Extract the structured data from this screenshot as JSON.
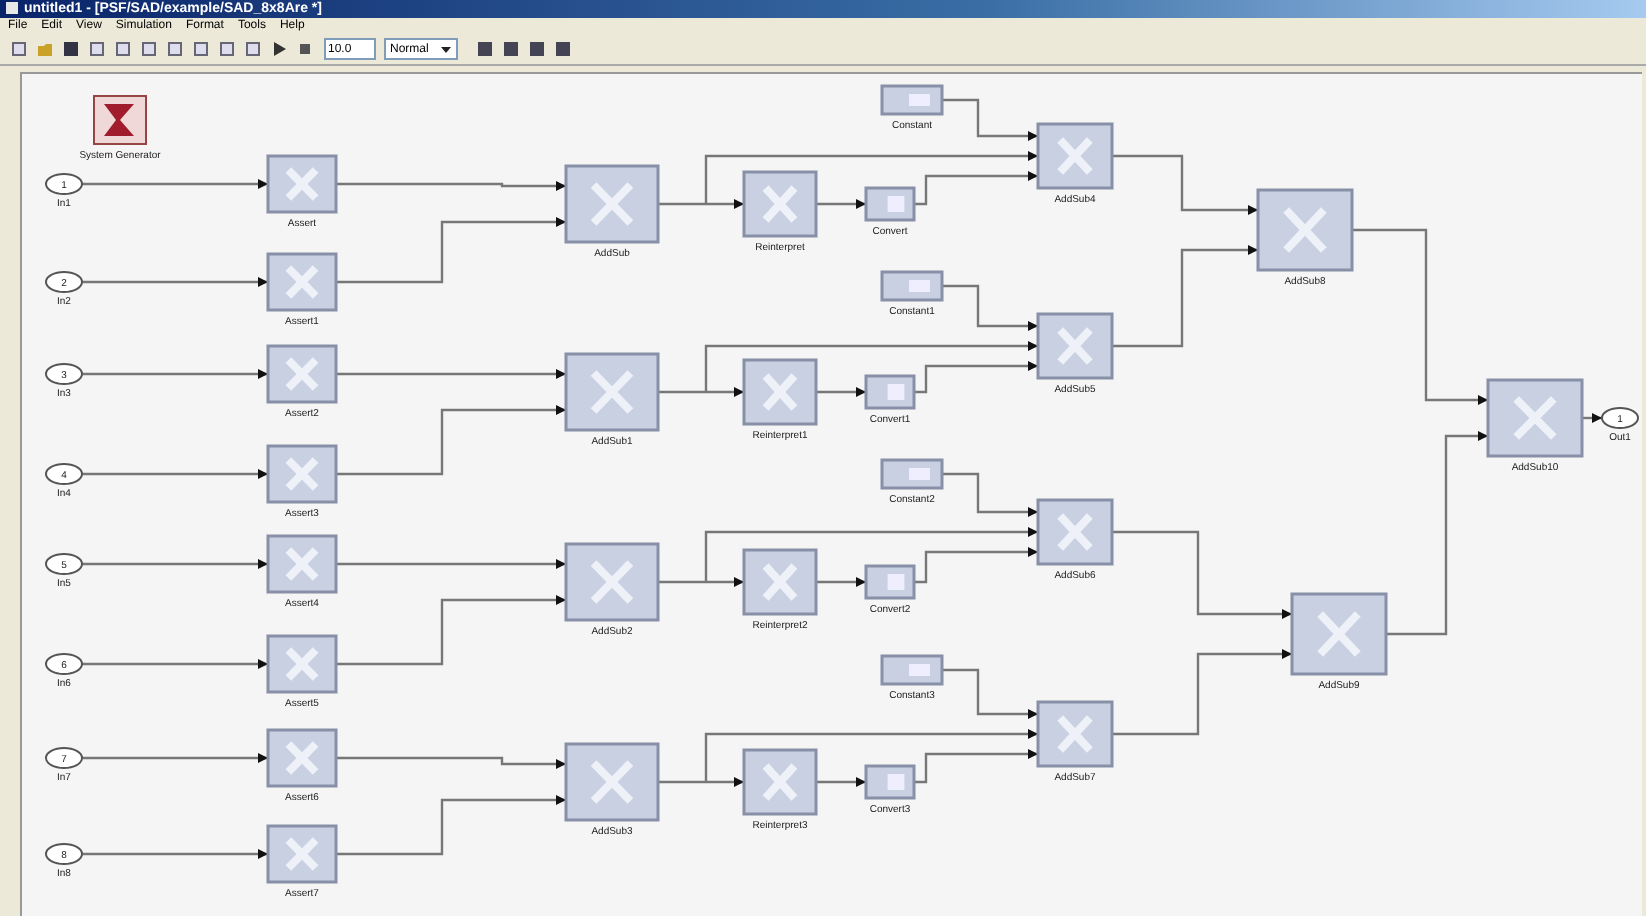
{
  "window": {
    "title": "untitled1 - [PSF/SAD/example/SAD_8x8Are *]"
  },
  "menu": [
    "File",
    "Edit",
    "View",
    "Simulation",
    "Format",
    "Tools",
    "Help"
  ],
  "toolbar": {
    "stop_time": "10.0",
    "mode": "Normal"
  },
  "diagram": {
    "system_generator": {
      "label": "System Generator"
    },
    "inports": [
      {
        "number": "1",
        "label": "In1"
      },
      {
        "number": "2",
        "label": "In2"
      },
      {
        "number": "3",
        "label": "In3"
      },
      {
        "number": "4",
        "label": "In4"
      },
      {
        "number": "5",
        "label": "In5"
      },
      {
        "number": "6",
        "label": "In6"
      },
      {
        "number": "7",
        "label": "In7"
      },
      {
        "number": "8",
        "label": "In8"
      }
    ],
    "input_blocks": [
      "Assert",
      "Assert1",
      "Assert2",
      "Assert3",
      "Assert4",
      "Assert5",
      "Assert6",
      "Assert7"
    ],
    "adders": [
      "AddSub",
      "AddSub1",
      "AddSub2",
      "AddSub3"
    ],
    "reinterprets": [
      "Reinterpret",
      "Reinterpret1",
      "Reinterpret2",
      "Reinterpret3"
    ],
    "converts": [
      "Convert",
      "Convert1",
      "Convert2",
      "Convert3"
    ],
    "constants": [
      "Constant",
      "Constant1",
      "Constant2",
      "Constant3"
    ],
    "muxes": [
      "AddSub4",
      "AddSub5",
      "AddSub6",
      "AddSub7"
    ],
    "adders_2": [
      "AddSub8",
      "AddSub9"
    ],
    "final": {
      "label": "AddSub10"
    },
    "outport": {
      "number": "1",
      "label": "Out1"
    }
  }
}
